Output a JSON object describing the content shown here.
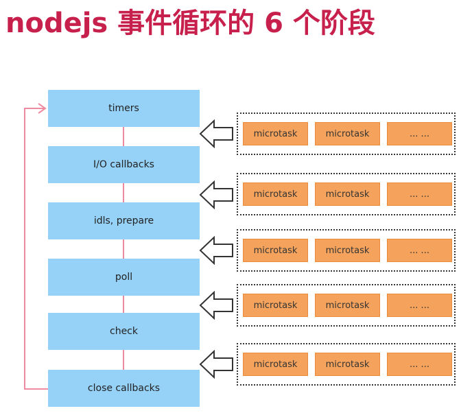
{
  "title": "nodejs 事件循环的 6 个阶段",
  "phases": [
    {
      "label": "timers"
    },
    {
      "label": "I/O callbacks"
    },
    {
      "label": "idls, prepare"
    },
    {
      "label": "poll"
    },
    {
      "label": "check"
    },
    {
      "label": "close callbacks"
    }
  ],
  "microtask_groups": [
    {
      "items": [
        "microtask",
        "microtask",
        "... ..."
      ]
    },
    {
      "items": [
        "microtask",
        "microtask",
        "... ..."
      ]
    },
    {
      "items": [
        "microtask",
        "microtask",
        "... ..."
      ]
    },
    {
      "items": [
        "microtask",
        "microtask",
        "... ..."
      ]
    },
    {
      "items": [
        "microtask",
        "microtask",
        "... ..."
      ]
    }
  ],
  "colors": {
    "title": "#c8204d",
    "phase_box": "#96d1f7",
    "connector": "#f08aa0",
    "microtask_chip": "#f5a35c"
  }
}
